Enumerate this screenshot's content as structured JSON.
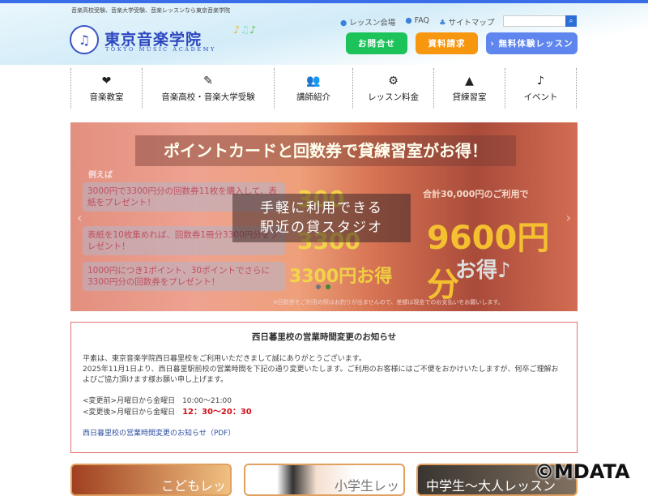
{
  "header": {
    "tagline": "音楽高校受験、音楽大学受験、音楽レッスンなら東京音楽学院",
    "logo_jp": "東京音楽学院",
    "logo_en": "TOKYO MUSIC ACADEMY",
    "links": [
      {
        "icon": "map-pin-icon",
        "label": "レッスン会場"
      },
      {
        "icon": "faq-icon",
        "label": "FAQ"
      },
      {
        "icon": "sitemap-icon",
        "label": "サイトマップ"
      }
    ],
    "search_placeholder": "",
    "search_icon": "search-icon",
    "buttons": {
      "contact": "お問合せ",
      "request": "資料請求",
      "trial": "› 無料体験レッスン"
    }
  },
  "nav": [
    {
      "icon": "piano-icon",
      "label": "音楽教室"
    },
    {
      "icon": "pencil-icon",
      "label": "音楽高校・音楽大学受験"
    },
    {
      "icon": "people-icon",
      "label": "講師紹介"
    },
    {
      "icon": "gears-icon",
      "label": "レッスン料金"
    },
    {
      "icon": "metronome-icon",
      "label": "貸練習室"
    },
    {
      "icon": "music-note-icon",
      "label": "イベント"
    }
  ],
  "banner": {
    "title": "ポイントカードと回数券で貸練習室がお得！",
    "example": "例えば",
    "box1": "3000円で3300円分の回数券11枚を購入して、表紙をプレゼント！",
    "box2": "表紙を10枚集めれば、回数券1冊分3300円分をプレゼント！",
    "box3": "1000円につき1ポイント、30ポイントでさらに3300円分の回数券をプレゼント！",
    "y1": "300",
    "y2": "3300",
    "y3": "3300円お得",
    "center_line1": "手軽に利用できる",
    "center_line2": "駅近の貸スタジオ",
    "right_line": "合計30,000円のご利用で",
    "big": "9600円分",
    "otoku": "お得♪",
    "footnote": "※回数券をご利用の際はお釣りが出ませんので、差額は現金でのお支払いをお願いします。",
    "slides": 2,
    "active_slide": 2
  },
  "notice": {
    "title": "西日暮里校の営業時間変更のお知らせ",
    "p1": "平素は、東京音楽学院西日暮里校をご利用いただきまして誠にありがとうございます。",
    "p2": "2025年11月1日より、西日暮里駅前校の営業時間を下記の通り変更いたします。ご利用のお客様にはご不便をおかけいたしますが、何卒ご理解およびご協力頂けます様お願い申し上げます。",
    "before_label": "<変更前>月曜日から金曜日　10:00～21:00",
    "after_label": "<変更後>月曜日から金曜日　",
    "after_time": "12：30～20：30",
    "link": "西日暮里校の営業時間変更のお知らせ（PDF）"
  },
  "cards": [
    "こどもレッスン",
    "小学生レッスン",
    "中学生～大人レッスン"
  ],
  "watermark": "©MDATA"
}
